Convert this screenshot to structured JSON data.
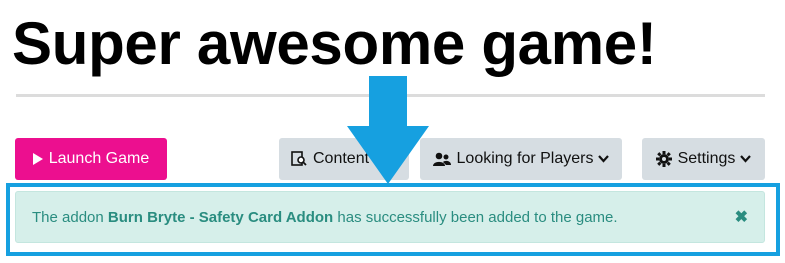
{
  "header": {
    "title": "Super awesome game!"
  },
  "toolbar": {
    "launch_label": "Launch Game",
    "content_label": "Content",
    "looking_label": "Looking for Players",
    "settings_label": "Settings"
  },
  "alert": {
    "prefix": "The addon ",
    "addon_name": "Burn Bryte - Safety Card Addon",
    "suffix": " has successfully been added to the game.",
    "close_glyph": "✖"
  },
  "colors": {
    "launch": "#ec0f8f",
    "secondary_button": "#d6dde2",
    "alert_bg": "#d6efea",
    "alert_text": "#2a8d80",
    "highlight": "#16a0e0"
  },
  "icons": [
    "play-icon",
    "content-icon",
    "users-icon",
    "gear-icon",
    "chevron-down-icon",
    "close-icon",
    "arrow-down-icon"
  ]
}
